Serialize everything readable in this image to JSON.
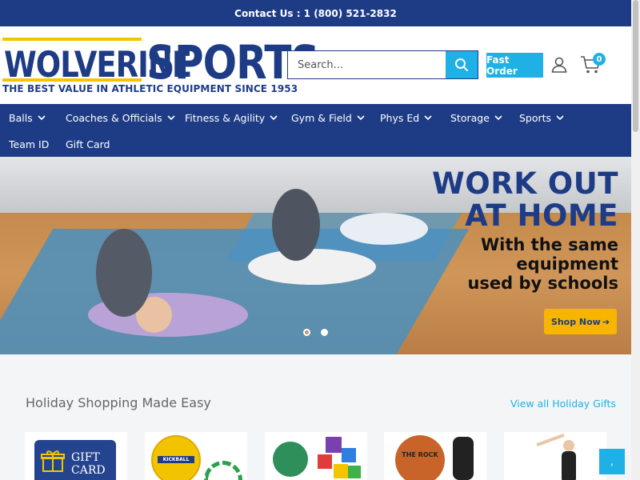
{
  "topbar": {
    "contact": "Contact Us : 1 (800) 521-2832"
  },
  "header": {
    "logo_word1": "WOLVERINE",
    "logo_word2": "SPORTS",
    "logo_tagline": "THE BEST VALUE IN ATHLETIC EQUIPMENT SINCE 1953",
    "search_placeholder": "Search...",
    "search_icon": "search-icon",
    "fast_order_label": "Fast Order",
    "account_icon": "user-icon",
    "cart_icon": "cart-icon",
    "cart_count": "0"
  },
  "nav": {
    "items": [
      {
        "label": "Balls",
        "has_dropdown": true
      },
      {
        "label": "Coaches & Officials",
        "has_dropdown": true
      },
      {
        "label": "Fitness & Agility",
        "has_dropdown": true
      },
      {
        "label": "Gym & Field",
        "has_dropdown": true
      },
      {
        "label": "Phys Ed",
        "has_dropdown": true
      },
      {
        "label": "Storage",
        "has_dropdown": true
      },
      {
        "label": "Sports",
        "has_dropdown": true
      },
      {
        "label": "Team ID",
        "has_dropdown": false
      },
      {
        "label": "Gift Card",
        "has_dropdown": false
      }
    ]
  },
  "hero": {
    "headline_line1": "WORK OUT",
    "headline_line2": "AT HOME",
    "sub_line1": "With the same",
    "sub_line2": "equipment",
    "sub_line3": "used by schools",
    "cta_label": "Shop Now",
    "cta_arrow": "➔",
    "slide_count": 2,
    "active_slide": 1
  },
  "holiday": {
    "title": "Holiday Shopping Made Easy",
    "view_all": "View all Holiday Gifts",
    "gift_card_text1": "GIFT",
    "gift_card_text2": "CARD",
    "kickball_text": "KICKBALL",
    "basketball_text": "THE ROCK"
  },
  "chat": {
    "label": ","
  },
  "colors": {
    "brand_navy": "#1e3c86",
    "accent_cyan": "#1fb1e6",
    "logo_yellow": "#f4c400",
    "cta_yellow": "#f7b500"
  }
}
